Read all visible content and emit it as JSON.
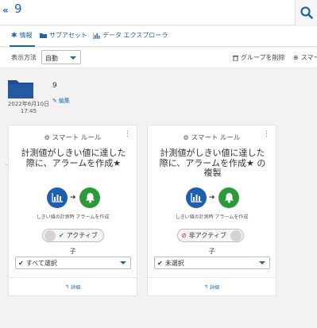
{
  "header": {
    "back_icon": "double-chevron-left-icon",
    "title": "9",
    "search_icon": "search-icon"
  },
  "tabs": [
    {
      "label": "情報",
      "icon": "asterisk-icon",
      "active": true
    },
    {
      "label": "サブアセット",
      "icon": "folder-icon",
      "active": false
    },
    {
      "label": "データ エクスプローラ",
      "icon": "bar-chart-icon",
      "active": false
    }
  ],
  "toolbar": {
    "display_label": "表示方法",
    "display_value": "自動",
    "delete_group": "グループを削除",
    "smart_rule_truncated": "スマー"
  },
  "group": {
    "name": "9",
    "edit_label": "編集",
    "date": "2022年6月10日",
    "time": "17:45"
  },
  "stray_mark": "-",
  "cards": [
    {
      "type_label": "スマート ルール",
      "title": "計測値がしきい値に達した際に、アラームを作成★",
      "flow_caption": "しきい値の計測時 アラームを作成",
      "status_label": "アクティブ",
      "status_active": true,
      "child_label": "子",
      "select_value": "すべて選択",
      "details_label": "詳細"
    },
    {
      "type_label": "スマート ルール",
      "title": "計測値がしきい値に達した際に、アラームを作成★ の複製",
      "flow_caption": "しきい値の計測時 アラームを作成",
      "status_label": "非アクティブ",
      "status_active": false,
      "child_label": "子",
      "select_value": "未選択",
      "details_label": "詳細"
    }
  ],
  "colors": {
    "accent": "#1a66a8",
    "measure_circle": "#1f5fb0",
    "alarm_circle": "#2c9a3b",
    "active_check": "#2c9a3b",
    "inactive_stop": "#d32f2f",
    "folder": "#1f4f8c"
  }
}
